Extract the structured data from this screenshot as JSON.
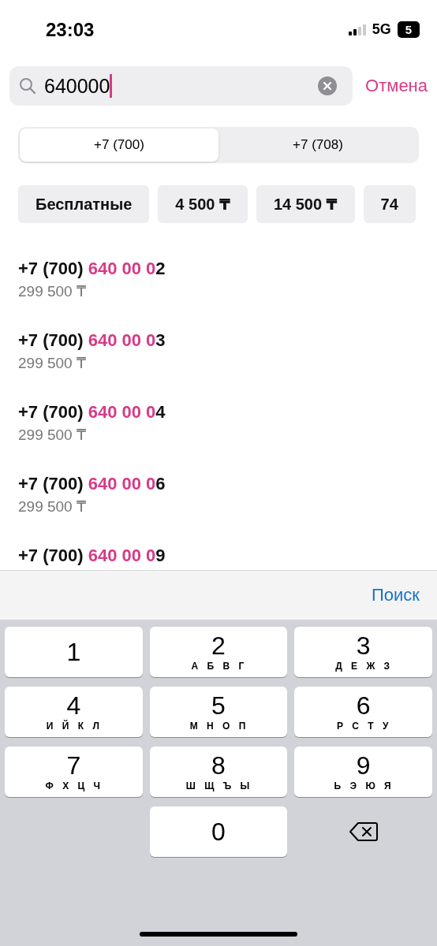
{
  "status_bar": {
    "time": "23:03",
    "network": "5G",
    "battery": "5"
  },
  "search": {
    "value": "640000",
    "cancel": "Отмена"
  },
  "tabs": [
    {
      "label": "+7 (700)",
      "selected": true
    },
    {
      "label": "+7 (708)",
      "selected": false
    }
  ],
  "filters": [
    "Бесплатные",
    "4 500 ₸",
    "14 500 ₸",
    "74"
  ],
  "numbers": [
    {
      "prefix": "+7 (700) ",
      "match": "640 00 0",
      "rest": "2",
      "price": "299 500 ₸"
    },
    {
      "prefix": "+7 (700) ",
      "match": "640 00 0",
      "rest": "3",
      "price": "299 500 ₸"
    },
    {
      "prefix": "+7 (700) ",
      "match": "640 00 0",
      "rest": "4",
      "price": "299 500 ₸"
    },
    {
      "prefix": "+7 (700) ",
      "match": "640 00 0",
      "rest": "6",
      "price": "299 500 ₸"
    },
    {
      "prefix": "+7 (700) ",
      "match": "640 00 0",
      "rest": "9"
    }
  ],
  "keyboard": {
    "action": "Поиск",
    "keys": [
      {
        "kind": "digit",
        "digit": "1"
      },
      {
        "kind": "digit",
        "digit": "2",
        "letters": "А Б В Г"
      },
      {
        "kind": "digit",
        "digit": "3",
        "letters": "Д Е Ж З"
      },
      {
        "kind": "digit",
        "digit": "4",
        "letters": "И Й К Л"
      },
      {
        "kind": "digit",
        "digit": "5",
        "letters": "М Н О П"
      },
      {
        "kind": "digit",
        "digit": "6",
        "letters": "Р С Т У"
      },
      {
        "kind": "digit",
        "digit": "7",
        "letters": "Ф Х Ц Ч"
      },
      {
        "kind": "digit",
        "digit": "8",
        "letters": "Ш Щ Ъ Ы"
      },
      {
        "kind": "digit",
        "digit": "9",
        "letters": "Ь Э Ю Я"
      },
      {
        "kind": "blank"
      },
      {
        "kind": "digit",
        "digit": "0"
      },
      {
        "kind": "delete"
      }
    ]
  }
}
